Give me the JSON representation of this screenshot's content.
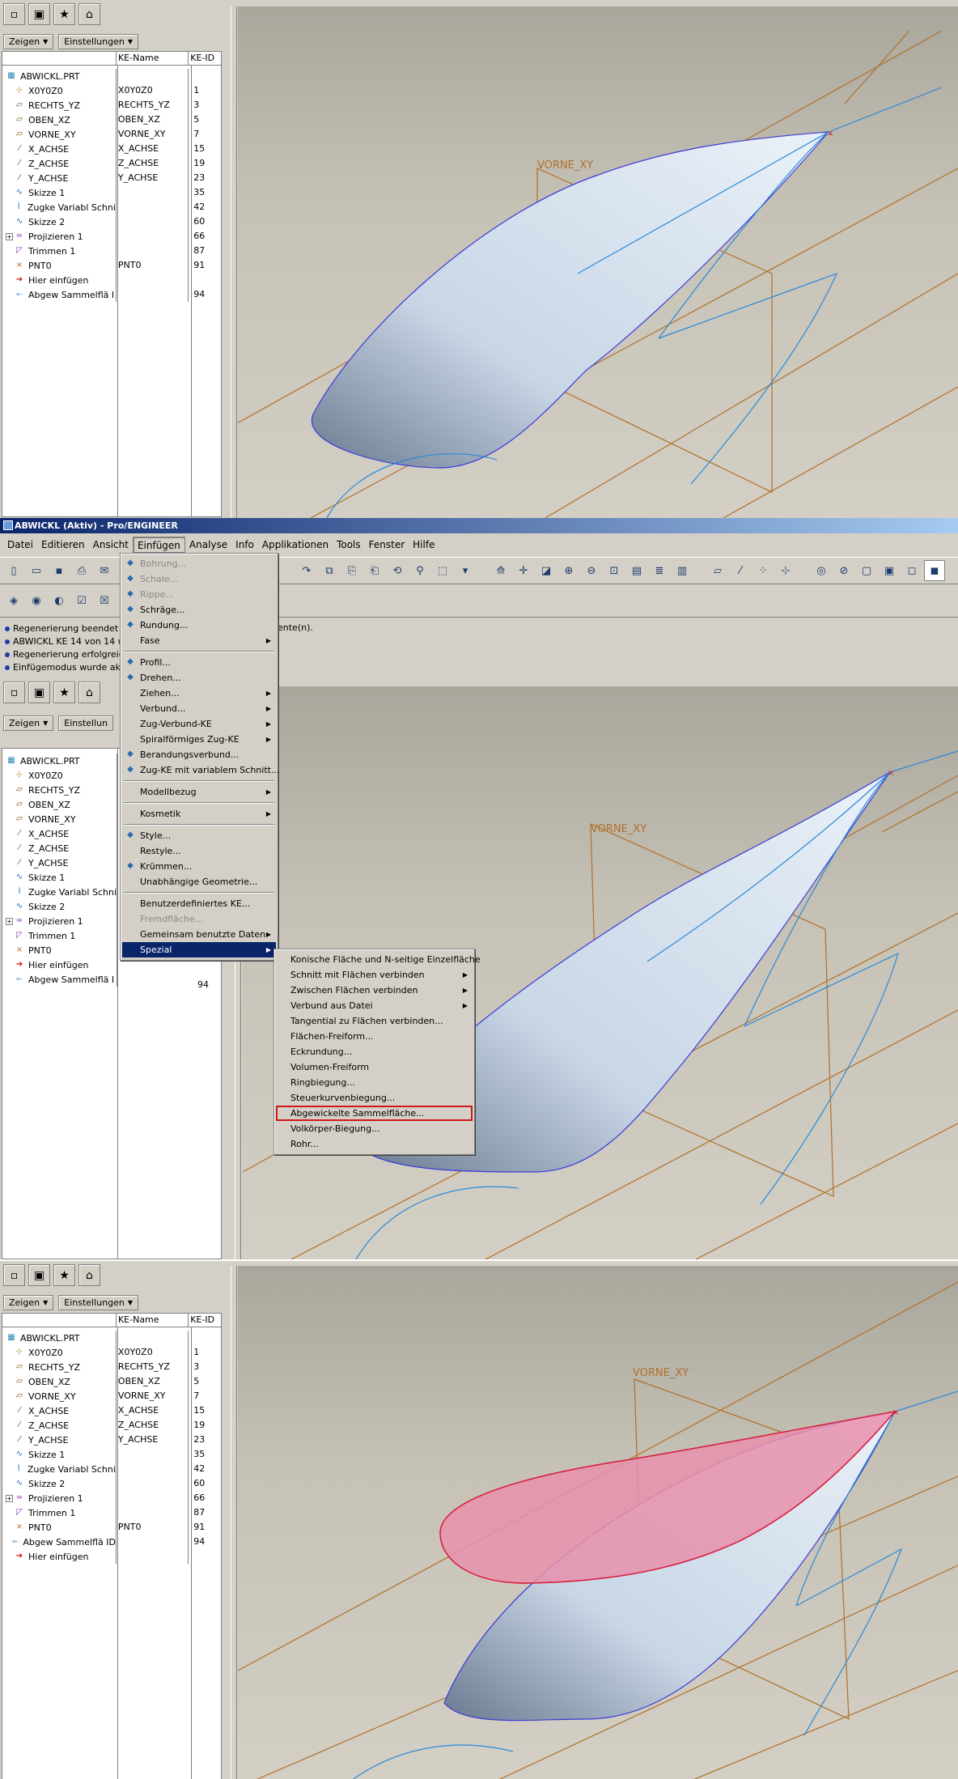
{
  "panel1": {
    "dropdowns": {
      "show": "Zeigen",
      "settings": "Einstellungen"
    },
    "columns": [
      "KE-Name",
      "KE-ID"
    ],
    "plane_label": "VORNE_XY",
    "tree": [
      {
        "label": "ABWICKL.PRT",
        "name": "",
        "id": "",
        "icon": "part"
      },
      {
        "label": "X0Y0Z0",
        "name": "X0Y0Z0",
        "id": "1",
        "icon": "csys"
      },
      {
        "label": "RECHTS_YZ",
        "name": "RECHTS_YZ",
        "id": "3",
        "icon": "plane"
      },
      {
        "label": "OBEN_XZ",
        "name": "OBEN_XZ",
        "id": "5",
        "icon": "plane"
      },
      {
        "label": "VORNE_XY",
        "name": "VORNE_XY",
        "id": "7",
        "icon": "plane"
      },
      {
        "label": "X_ACHSE",
        "name": "X_ACHSE",
        "id": "15",
        "icon": "axis"
      },
      {
        "label": "Z_ACHSE",
        "name": "Z_ACHSE",
        "id": "19",
        "icon": "axis"
      },
      {
        "label": "Y_ACHSE",
        "name": "Y_ACHSE",
        "id": "23",
        "icon": "axis"
      },
      {
        "label": "Skizze 1",
        "name": "",
        "id": "35",
        "icon": "sketch"
      },
      {
        "label": "Zugke Variabl Schni",
        "name": "",
        "id": "42",
        "icon": "sweep"
      },
      {
        "label": "Skizze 2",
        "name": "",
        "id": "60",
        "icon": "sketch"
      },
      {
        "label": "Projizieren 1",
        "name": "",
        "id": "66",
        "icon": "proj"
      },
      {
        "label": "Trimmen 1",
        "name": "",
        "id": "87",
        "icon": "trim"
      },
      {
        "label": "PNT0",
        "name": "PNT0",
        "id": "91",
        "icon": "point"
      },
      {
        "label": "Hier einfügen",
        "name": "",
        "id": "",
        "icon": "insert"
      },
      {
        "label": "Abgew Sammelflä I",
        "name": "",
        "id": "94",
        "icon": "flat"
      }
    ]
  },
  "panel2": {
    "window_title": "ABWICKL (Aktiv) - Pro/ENGINEER",
    "menubar": [
      "Datei",
      "Editieren",
      "Ansicht",
      "Einfügen",
      "Analyse",
      "Info",
      "Applikationen",
      "Tools",
      "Fenster",
      "Hilfe"
    ],
    "messages": [
      "Regenerierung beendet m",
      "ABWICKL KE 14 von 14 wi",
      "Regenerierung erfolgreich",
      "Einfügemodus wurde aktiv"
    ],
    "message_tail": "ente(n).",
    "dropdowns": {
      "show": "Zeigen",
      "settings": "Einstellun"
    },
    "plane_label": "VORNE_XY",
    "tree": [
      {
        "label": "ABWICKL.PRT",
        "icon": "part"
      },
      {
        "label": "X0Y0Z0",
        "icon": "csys"
      },
      {
        "label": "RECHTS_YZ",
        "icon": "plane"
      },
      {
        "label": "OBEN_XZ",
        "icon": "plane"
      },
      {
        "label": "VORNE_XY",
        "icon": "plane"
      },
      {
        "label": "X_ACHSE",
        "icon": "axis"
      },
      {
        "label": "Z_ACHSE",
        "icon": "axis"
      },
      {
        "label": "Y_ACHSE",
        "icon": "axis"
      },
      {
        "label": "Skizze 1",
        "icon": "sketch"
      },
      {
        "label": "Zugke Variabl Schni",
        "icon": "sweep"
      },
      {
        "label": "Skizze 2",
        "icon": "sketch"
      },
      {
        "label": "Projizieren 1",
        "icon": "proj"
      },
      {
        "label": "Trimmen 1",
        "icon": "trim"
      },
      {
        "label": "PNT0",
        "icon": "point"
      },
      {
        "label": "Hier einfügen",
        "icon": "insert"
      },
      {
        "label": "Abgew Sammelflä I",
        "icon": "flat"
      }
    ],
    "tree_last_id": "94",
    "insert_menu": [
      {
        "label": "Bohrung...",
        "disabled": true,
        "icon": "hole"
      },
      {
        "label": "Schale...",
        "disabled": true,
        "icon": "shell"
      },
      {
        "label": "Rippe...",
        "disabled": true,
        "icon": "rib"
      },
      {
        "label": "Schräge...",
        "icon": "draft"
      },
      {
        "label": "Rundung...",
        "icon": "round"
      },
      {
        "label": "Fase",
        "submenu": true
      },
      {
        "sep": true
      },
      {
        "label": "Profil...",
        "icon": "extrude"
      },
      {
        "label": "Drehen...",
        "icon": "revolve"
      },
      {
        "label": "Ziehen...",
        "submenu": true
      },
      {
        "label": "Verbund...",
        "submenu": true
      },
      {
        "label": "Zug-Verbund-KE",
        "submenu": true
      },
      {
        "label": "Spiralförmiges Zug-KE",
        "submenu": true
      },
      {
        "label": "Berandungsverbund...",
        "icon": "boundary"
      },
      {
        "label": "Zug-KE mit variablem Schnitt...",
        "icon": "vss"
      },
      {
        "sep": true
      },
      {
        "label": "Modellbezug",
        "submenu": true
      },
      {
        "sep": true
      },
      {
        "label": "Kosmetik",
        "submenu": true
      },
      {
        "sep": true
      },
      {
        "label": "Style...",
        "icon": "style"
      },
      {
        "label": "Restyle..."
      },
      {
        "label": "Krümmen...",
        "icon": "warp"
      },
      {
        "label": "Unabhängige Geometrie..."
      },
      {
        "sep": true
      },
      {
        "label": "Benutzerdefiniertes KE..."
      },
      {
        "label": "Fremdfläche...",
        "disabled": true
      },
      {
        "label": "Gemeinsam benutzte Daten",
        "submenu": true
      },
      {
        "label": "Spezial",
        "submenu": true,
        "selected": true
      }
    ],
    "special_menu": [
      {
        "label": "Konische Fläche und N-seitige Einzelfläche"
      },
      {
        "label": "Schnitt mit Flächen verbinden",
        "submenu": true
      },
      {
        "label": "Zwischen Flächen verbinden",
        "submenu": true
      },
      {
        "label": "Verbund aus Datei",
        "submenu": true
      },
      {
        "label": "Tangential zu Flächen verbinden..."
      },
      {
        "label": "Flächen-Freiform..."
      },
      {
        "label": "Eckrundung..."
      },
      {
        "label": "Volumen-Freiform"
      },
      {
        "label": "Ringbiegung..."
      },
      {
        "label": "Steuerkurvenbiegung..."
      },
      {
        "label": "Abgewickelte Sammelfläche...",
        "highlight": true
      },
      {
        "label": "Volkörper-Biegung..."
      },
      {
        "label": "Rohr..."
      }
    ]
  },
  "panel3": {
    "dropdowns": {
      "show": "Zeigen",
      "settings": "Einstellungen"
    },
    "columns": [
      "KE-Name",
      "KE-ID"
    ],
    "plane_label": "VORNE_XY",
    "tree": [
      {
        "label": "ABWICKL.PRT",
        "name": "",
        "id": "",
        "icon": "part"
      },
      {
        "label": "X0Y0Z0",
        "name": "X0Y0Z0",
        "id": "1",
        "icon": "csys"
      },
      {
        "label": "RECHTS_YZ",
        "name": "RECHTS_YZ",
        "id": "3",
        "icon": "plane"
      },
      {
        "label": "OBEN_XZ",
        "name": "OBEN_XZ",
        "id": "5",
        "icon": "plane"
      },
      {
        "label": "VORNE_XY",
        "name": "VORNE_XY",
        "id": "7",
        "icon": "plane"
      },
      {
        "label": "X_ACHSE",
        "name": "X_ACHSE",
        "id": "15",
        "icon": "axis"
      },
      {
        "label": "Z_ACHSE",
        "name": "Z_ACHSE",
        "id": "19",
        "icon": "axis"
      },
      {
        "label": "Y_ACHSE",
        "name": "Y_ACHSE",
        "id": "23",
        "icon": "axis"
      },
      {
        "label": "Skizze 1",
        "name": "",
        "id": "35",
        "icon": "sketch"
      },
      {
        "label": "Zugke Variabl Schni",
        "name": "",
        "id": "42",
        "icon": "sweep"
      },
      {
        "label": "Skizze 2",
        "name": "",
        "id": "60",
        "icon": "sketch"
      },
      {
        "label": "Projizieren 1",
        "name": "",
        "id": "66",
        "icon": "proj"
      },
      {
        "label": "Trimmen 1",
        "name": "",
        "id": "87",
        "icon": "trim"
      },
      {
        "label": "PNT0",
        "name": "PNT0",
        "id": "91",
        "icon": "point"
      },
      {
        "label": "Abgew Sammelflä ID",
        "name": "",
        "id": "94",
        "icon": "flat"
      },
      {
        "label": "Hier einfügen",
        "name": "",
        "id": "",
        "icon": "insert"
      }
    ]
  },
  "colors": {
    "datum": "#b0702a",
    "curve": "#2a8ad8",
    "edge": "#3a3ad8",
    "flat_fill": "#e890ac",
    "flat_edge": "#d82040",
    "highlight": "#d01818",
    "menu_select": "#0a246a"
  }
}
